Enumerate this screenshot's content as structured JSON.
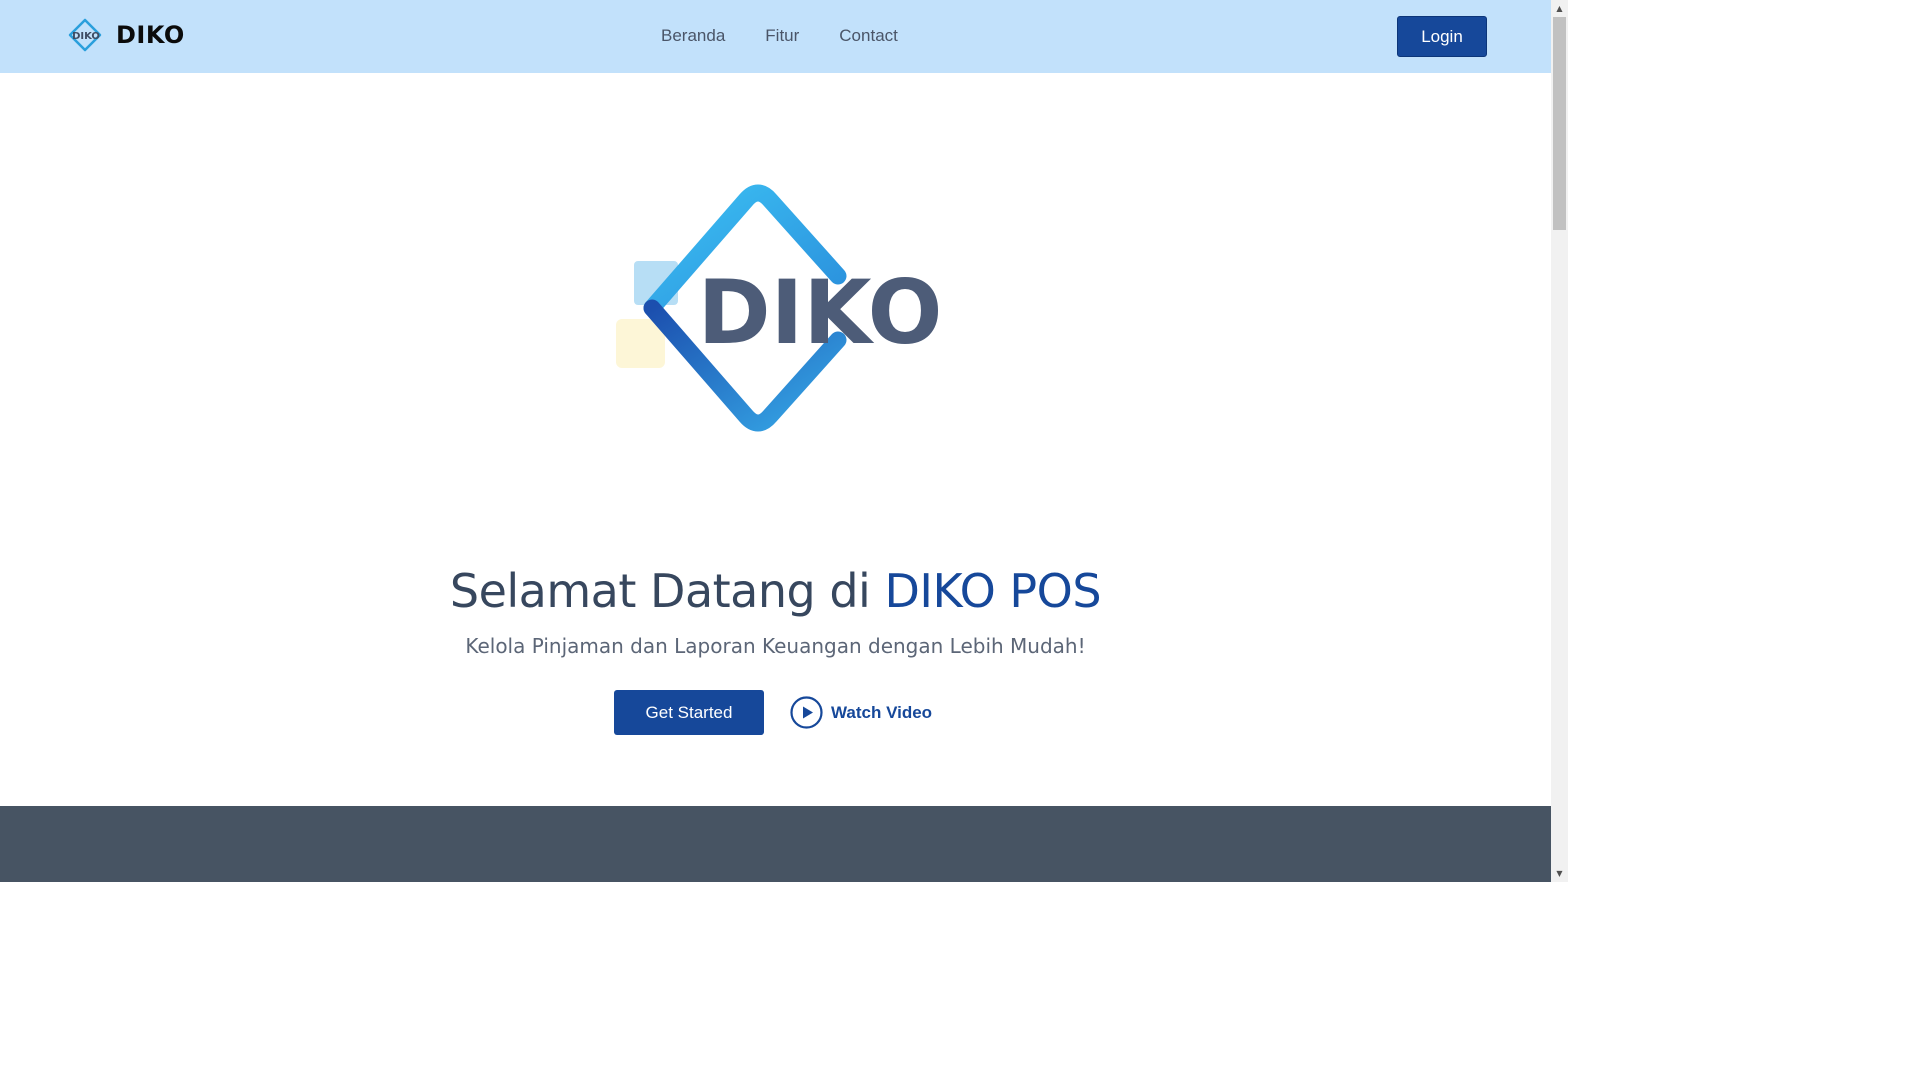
{
  "header": {
    "brand_name": "DIKO",
    "brand_logo_text": "DIKO",
    "nav": [
      {
        "label": "Beranda"
      },
      {
        "label": "Fitur"
      },
      {
        "label": "Contact"
      }
    ],
    "login_label": "Login"
  },
  "hero": {
    "logo_text": "DIKO",
    "title_prefix": "Selamat Datang di ",
    "title_accent": "DIKO POS",
    "subtitle": "Kelola Pinjaman dan Laporan Keuangan dengan Lebih Mudah!",
    "get_started_label": "Get Started",
    "watch_video_label": "Watch Video"
  },
  "icons": {
    "play": "play-circle-icon",
    "scroll_up": "scroll-up-arrow-icon",
    "scroll_down": "scroll-down-arrow-icon"
  },
  "colors": {
    "header_bg": "#c2e1fb",
    "primary": "#16489a",
    "heading": "#37475e",
    "footer_band": "#475463",
    "logo_light_blue": "#3bb5ef",
    "logo_dark_blue": "#1a5fb4",
    "logo_text": "#4d5c78"
  }
}
